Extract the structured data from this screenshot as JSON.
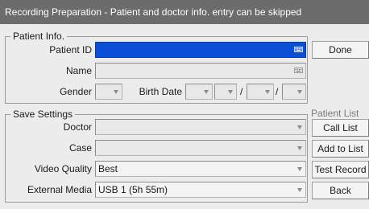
{
  "window": {
    "title": "Recording Preparation - Patient and doctor info. entry can be skipped"
  },
  "patient_info": {
    "group_title": "Patient Info.",
    "patient_id_label": "Patient ID",
    "patient_id_value": "",
    "name_label": "Name",
    "name_value": "",
    "gender_label": "Gender",
    "gender_value": "",
    "birth_date_label": "Birth Date",
    "birth_date_separator_1": "/",
    "birth_date_separator_2": "/",
    "birth_year_value": "",
    "birth_month_value": "",
    "birth_day_value": ""
  },
  "save_settings": {
    "group_title": "Save Settings",
    "doctor_label": "Doctor",
    "doctor_value": "",
    "case_label": "Case",
    "case_value": "",
    "video_quality_label": "Video Quality",
    "video_quality_value": "Best",
    "external_media_label": "External Media",
    "external_media_value": "USB 1 (5h 55m)"
  },
  "buttons": {
    "done": "Done",
    "patient_list_label": "Patient List",
    "call_list": "Call List",
    "add_to_list": "Add to List",
    "test_record": "Test Record",
    "back": "Back"
  },
  "icons": {
    "keyboard": "keyboard-icon",
    "dropdown": "chevron-down-icon"
  },
  "colors": {
    "titlebar": "#6c6c6c",
    "active_field": "#0a4fd6",
    "background": "#ececec"
  }
}
